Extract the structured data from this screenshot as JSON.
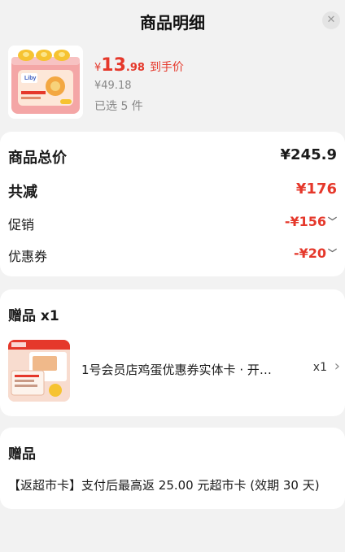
{
  "header": {
    "title": "商品明细",
    "close_glyph": "✕"
  },
  "product": {
    "price_currency": "¥",
    "price_int": "13",
    "price_dec": ".98",
    "price_tag": "到手价",
    "original_price": "¥49.18",
    "selected_count": "已选 5 件",
    "image_brand": "Liby"
  },
  "summary": {
    "total_label": "商品总价",
    "total_value": "¥245.9",
    "discount_label": "共减",
    "discount_value": "¥176",
    "promo_label": "促销",
    "promo_value": "-¥156",
    "coupon_label": "优惠券",
    "coupon_value": "-¥20"
  },
  "gift_section": {
    "title": "赠品 x1",
    "item_name": "1号会员店鸡蛋优惠券实体卡 · 开…",
    "item_qty": "x1"
  },
  "bonus_section": {
    "title": "赠品",
    "text": "【返超市卡】支付后最高返 25.00 元超市卡 (效期 30 天)"
  },
  "colors": {
    "accent_red": "#e5382b",
    "background": "#f2f2f2"
  }
}
